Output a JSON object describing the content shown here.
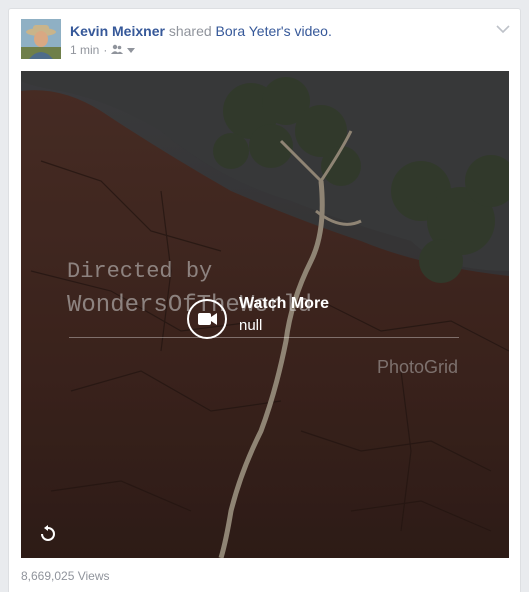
{
  "post": {
    "author": "Kevin Meixner",
    "action_shared": "shared",
    "source": "Bora Yeter",
    "source_suffix": "'s video.",
    "time": "1 min",
    "separator": "·",
    "audience_icon": "friends-icon",
    "menu_icon": "chevron-down-icon"
  },
  "video": {
    "overlay_title": "Watch More",
    "overlay_subtitle": "null",
    "watermark_line1": "Directed by",
    "watermark_line2": "WondersOfTheWorld",
    "watermark_app": "PhotoGrid",
    "camera_icon": "video-camera-icon",
    "replay_icon": "replay-icon"
  },
  "footer": {
    "views": "8,669,025 Views"
  },
  "colors": {
    "link": "#365899",
    "meta": "#90949c",
    "page_bg": "#e9ebee"
  }
}
